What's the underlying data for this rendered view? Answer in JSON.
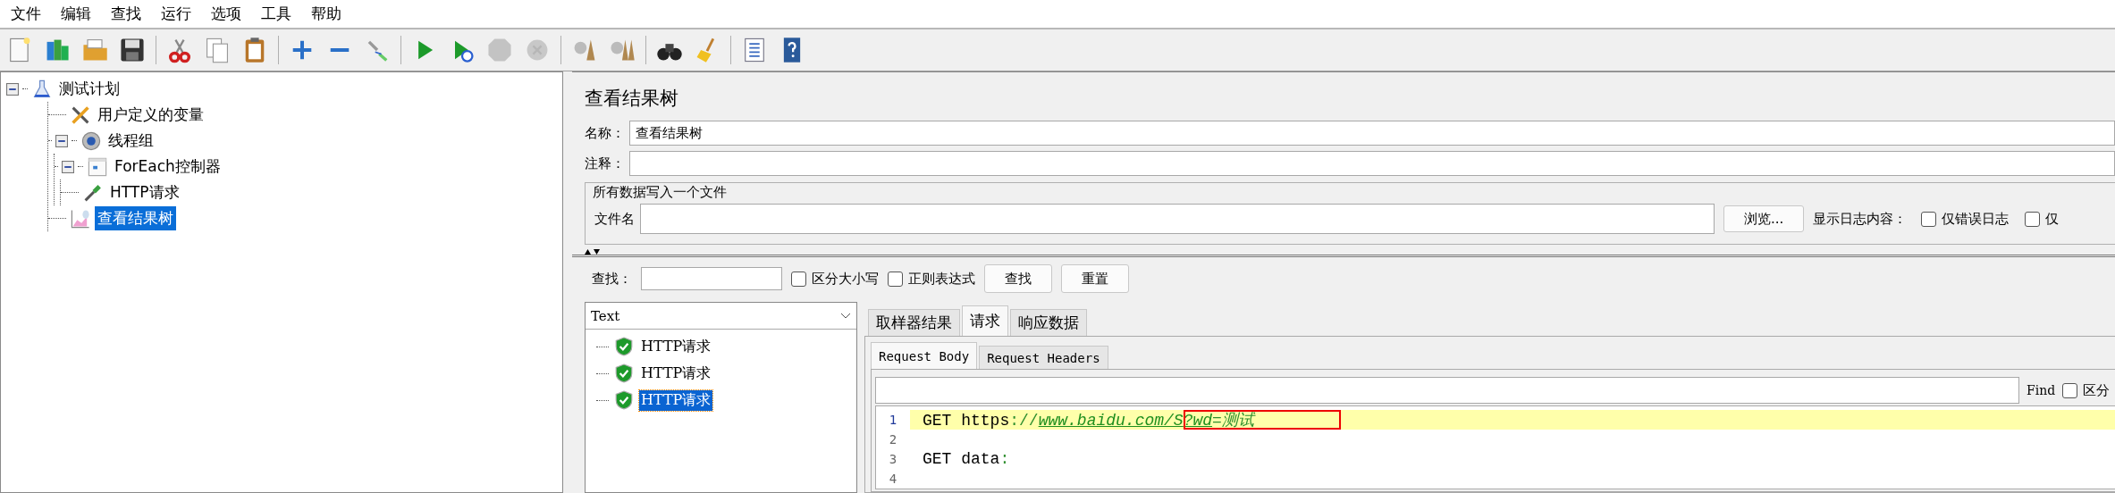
{
  "menu": [
    "文件",
    "编辑",
    "查找",
    "运行",
    "选项",
    "工具",
    "帮助"
  ],
  "toolbar": [
    [
      {
        "disabled": false
      },
      {
        "disabled": false
      },
      {
        "disabled": false
      },
      {
        "disabled": false
      }
    ],
    [
      {
        "disabled": false
      },
      {
        "disabled": false
      },
      {
        "disabled": false
      }
    ],
    [
      {
        "disabled": false
      },
      {
        "disabled": false
      },
      {
        "disabled": false
      }
    ],
    [
      {
        "disabled": false
      },
      {
        "disabled": false
      },
      {
        "disabled": true
      },
      {
        "disabled": true
      }
    ],
    [
      {
        "disabled": false
      },
      {
        "disabled": false
      }
    ],
    [
      {
        "disabled": false
      },
      {
        "disabled": false
      }
    ],
    [
      {
        "disabled": false
      },
      {
        "disabled": false
      }
    ]
  ],
  "tree": [
    {
      "label": "测试计划",
      "kind": "plan",
      "expanded": true,
      "selected": false,
      "children": [
        {
          "label": "用户定义的变量",
          "kind": "config",
          "selected": false
        },
        {
          "label": "线程组",
          "kind": "threads",
          "expanded": true,
          "selected": false,
          "children": [
            {
              "label": "ForEach控制器",
              "kind": "controller",
              "expanded": true,
              "selected": false,
              "children": [
                {
                  "label": "HTTP请求",
                  "kind": "sampler",
                  "selected": false
                }
              ]
            }
          ]
        },
        {
          "label": "查看结果树",
          "kind": "listener",
          "selected": true
        }
      ]
    }
  ],
  "panel": {
    "title": "查看结果树",
    "name_label": "名称：",
    "name_value": "查看结果树",
    "comment_label": "注释：",
    "file_group": {
      "title": "所有数据写入一个文件",
      "file_label": "文件名",
      "browse": "浏览...",
      "log_label": "显示日志内容：",
      "log_options": [
        {
          "label": "仅错误日志",
          "checked": false
        },
        {
          "label": "仅",
          "checked": false
        }
      ]
    },
    "search": {
      "label": "查找：",
      "options": [
        {
          "label": "区分大小写",
          "checked": false
        },
        {
          "label": "正则表达式",
          "checked": false
        }
      ],
      "buttons": [
        "查找",
        "重置"
      ]
    },
    "results": {
      "renderer": "Text",
      "items": [
        {
          "label": "HTTP请求",
          "selected": false
        },
        {
          "label": "HTTP请求",
          "selected": false
        },
        {
          "label": "HTTP请求",
          "selected": true
        }
      ]
    },
    "tabs": [
      {
        "label": "取样器结果",
        "selected": false
      },
      {
        "label": "请求",
        "selected": true
      },
      {
        "label": "响应数据",
        "selected": false
      }
    ],
    "subtabs": [
      {
        "label": "Request Body",
        "selected": true
      },
      {
        "label": "Request Headers",
        "selected": false
      }
    ],
    "find": {
      "label": "Find",
      "option": {
        "label": "区分",
        "checked": false
      }
    },
    "code": [
      {
        "number": "1",
        "highlighted": true,
        "segments": [
          {
            "kind": "plain",
            "text": "GET https",
            "boxed": false
          },
          {
            "kind": "punct",
            "text": "://",
            "boxed": false
          },
          {
            "kind": "link",
            "text": "www.baidu.com/S",
            "boxed": false
          },
          {
            "kind": "link",
            "text": "?wd",
            "boxed": true
          },
          {
            "kind": "value",
            "text": "=测试",
            "boxed": true
          }
        ]
      },
      {
        "number": "2",
        "highlighted": false
      },
      {
        "number": "3",
        "highlighted": false,
        "segments": [
          {
            "kind": "plain",
            "text": "GET data",
            "boxed": false
          },
          {
            "kind": "punct",
            "text": ":",
            "boxed": false
          }
        ]
      },
      {
        "number": "4",
        "highlighted": false
      }
    ]
  }
}
